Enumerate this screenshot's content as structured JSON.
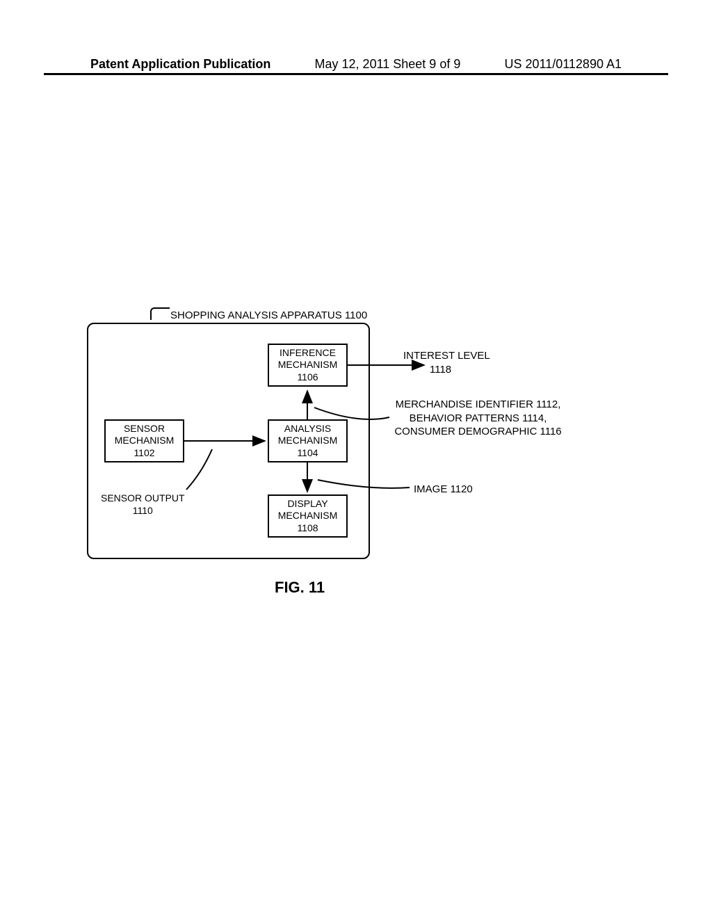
{
  "header": {
    "left": "Patent Application Publication",
    "center": "May 12, 2011  Sheet 9 of 9",
    "right": "US 2011/0112890 A1"
  },
  "diagram": {
    "title": "SHOPPING ANALYSIS APPARATUS 1100",
    "blocks": {
      "sensor": {
        "line1": "SENSOR",
        "line2": "MECHANISM",
        "line3": "1102"
      },
      "analysis": {
        "line1": "ANALYSIS",
        "line2": "MECHANISM",
        "line3": "1104"
      },
      "inference": {
        "line1": "INFERENCE",
        "line2": "MECHANISM",
        "line3": "1106"
      },
      "display": {
        "line1": "DISPLAY",
        "line2": "MECHANISM",
        "line3": "1108"
      }
    },
    "labels": {
      "sensor_output": {
        "line1": "SENSOR OUTPUT",
        "line2": "1110"
      },
      "interest": {
        "line1": "INTEREST LEVEL",
        "line2": "1118"
      },
      "merch": {
        "line1": "MERCHANDISE IDENTIFIER 1112,",
        "line2": "BEHAVIOR PATTERNS 1114,",
        "line3": "CONSUMER DEMOGRAPHIC 1116"
      },
      "image": "IMAGE 1120"
    },
    "figure_caption": "FIG. 11"
  }
}
